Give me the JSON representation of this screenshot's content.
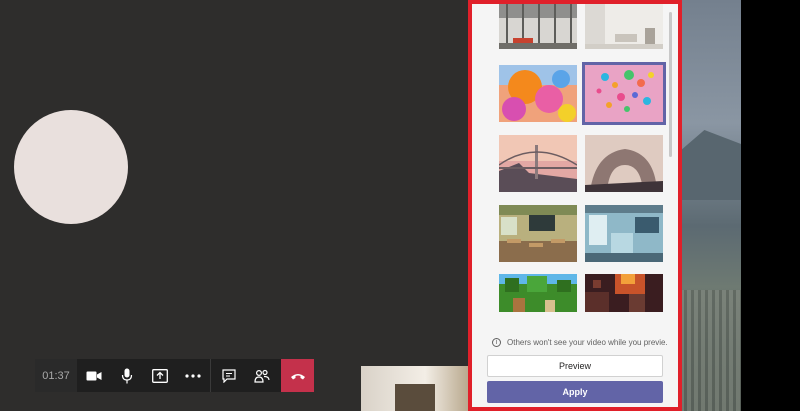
{
  "call": {
    "timer": "01:37",
    "toolbar": {
      "video_icon": "video-camera-icon",
      "mic_icon": "microphone-icon",
      "share_icon": "share-screen-icon",
      "more_icon": "more-options-icon",
      "chat_icon": "chat-icon",
      "people_icon": "participants-icon",
      "hangup_icon": "hang-up-icon",
      "hangup_color": "#c4314b"
    }
  },
  "background_panel": {
    "border_color": "#e0202a",
    "accent": "#6264a7",
    "thumbnails": [
      {
        "name": "office-atrium",
        "selected": false
      },
      {
        "name": "white-room",
        "selected": false
      },
      {
        "name": "orange-balloons",
        "selected": false
      },
      {
        "name": "pink-balls",
        "selected": true
      },
      {
        "name": "bridge-sunset",
        "selected": false
      },
      {
        "name": "rock-arch",
        "selected": false
      },
      {
        "name": "classroom",
        "selected": false
      },
      {
        "name": "lab-office",
        "selected": false
      },
      {
        "name": "minecraft-green",
        "selected": false
      },
      {
        "name": "minecraft-lava",
        "selected": false
      }
    ],
    "notice_icon": "info-icon",
    "notice_text": "Others won't see your video while you previe...",
    "preview_label": "Preview",
    "apply_label": "Apply"
  }
}
